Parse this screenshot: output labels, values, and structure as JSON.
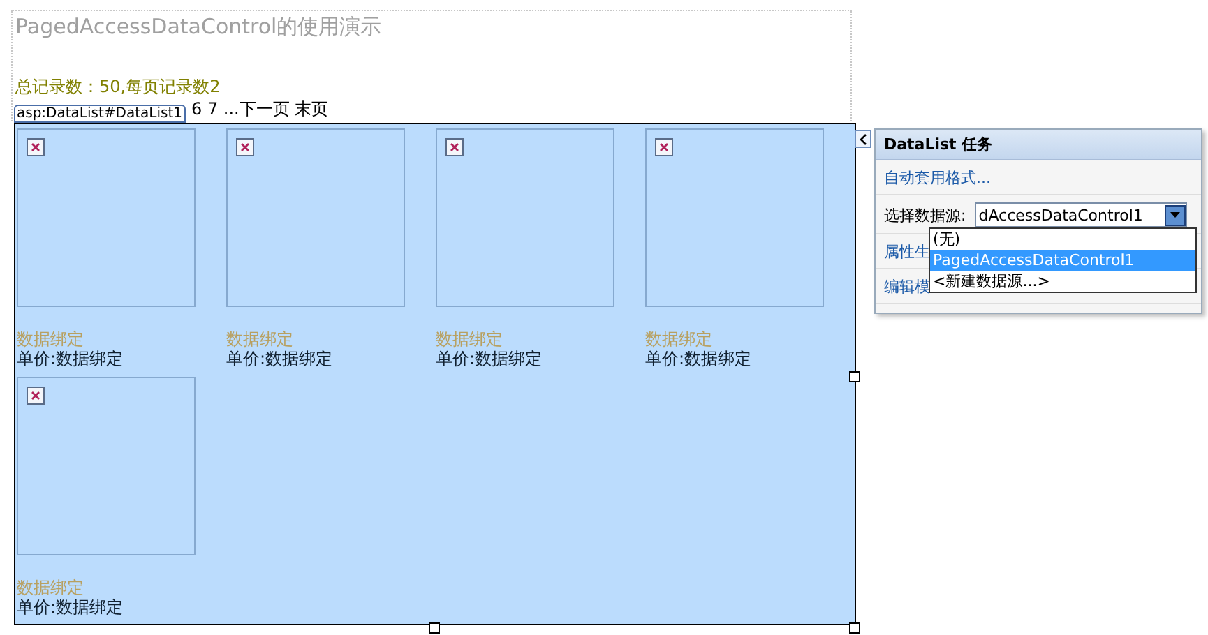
{
  "page": {
    "title": "PagedAccessDataControl的使用演示",
    "summary": "总记录数：50,每页记录数2",
    "pager": "6 7 ...下一页 末页",
    "control_tag": "asp:DataList#DataList1"
  },
  "datalist": {
    "items": [
      {
        "caption": "数据绑定",
        "price": "单价:数据绑定"
      },
      {
        "caption": "数据绑定",
        "price": "单价:数据绑定"
      },
      {
        "caption": "数据绑定",
        "price": "单价:数据绑定"
      },
      {
        "caption": "数据绑定",
        "price": "单价:数据绑定"
      },
      {
        "caption": "数据绑定",
        "price": "单价:数据绑定"
      }
    ]
  },
  "tasks": {
    "title": "DataList 任务",
    "links": [
      {
        "label": "自动套用格式..."
      },
      {
        "kind": "select",
        "label": "选择数据源:",
        "value": "dAccessDataControl1",
        "expanded": true,
        "options": [
          {
            "label": "(无)",
            "selected": false
          },
          {
            "label": "PagedAccessDataControl1",
            "selected": true
          },
          {
            "label": "<新建数据源...>",
            "selected": false
          }
        ]
      },
      {
        "label": "属性生"
      },
      {
        "label": "编辑模"
      }
    ]
  }
}
